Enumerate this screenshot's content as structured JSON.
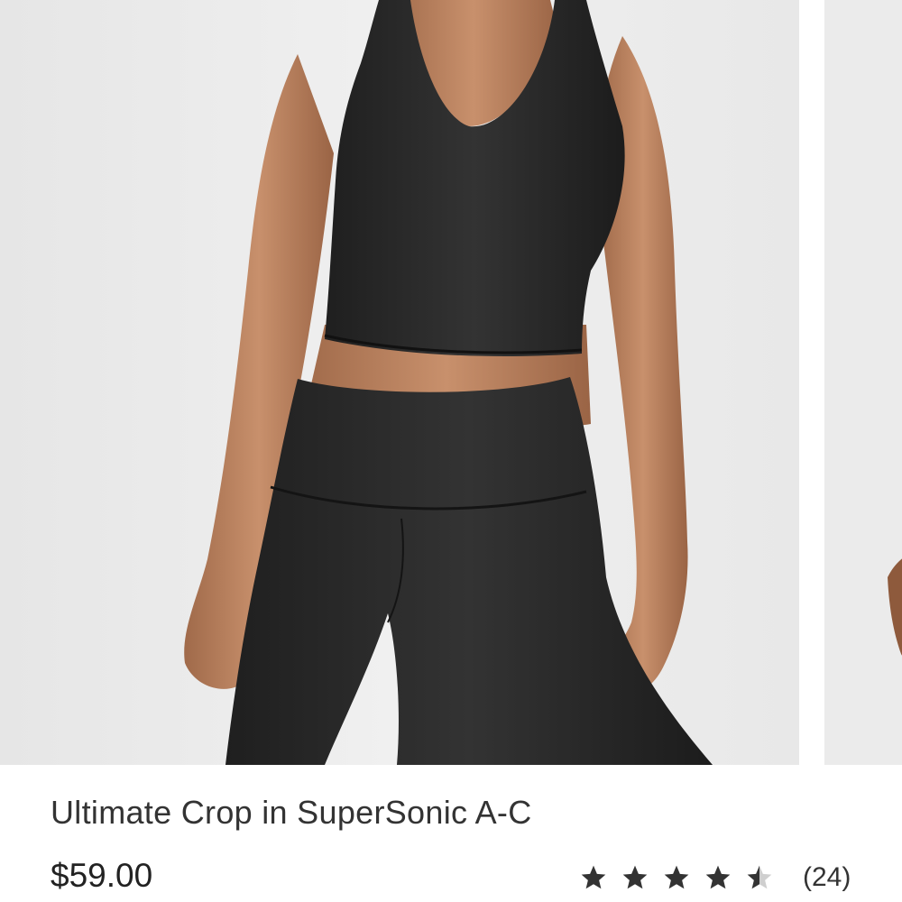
{
  "product": {
    "name": "Ultimate Crop in SuperSonic A-C",
    "price": "$59.00",
    "image_alt": "Model wearing black crop top and black high-rise tights",
    "rating": {
      "stars": 4.5,
      "max_stars": 5,
      "review_count": "(24)"
    }
  },
  "colors": {
    "star": "#333333",
    "star_empty": "#cfcfcf",
    "garment": "#2a2a2a",
    "backdrop": "#ececec"
  }
}
